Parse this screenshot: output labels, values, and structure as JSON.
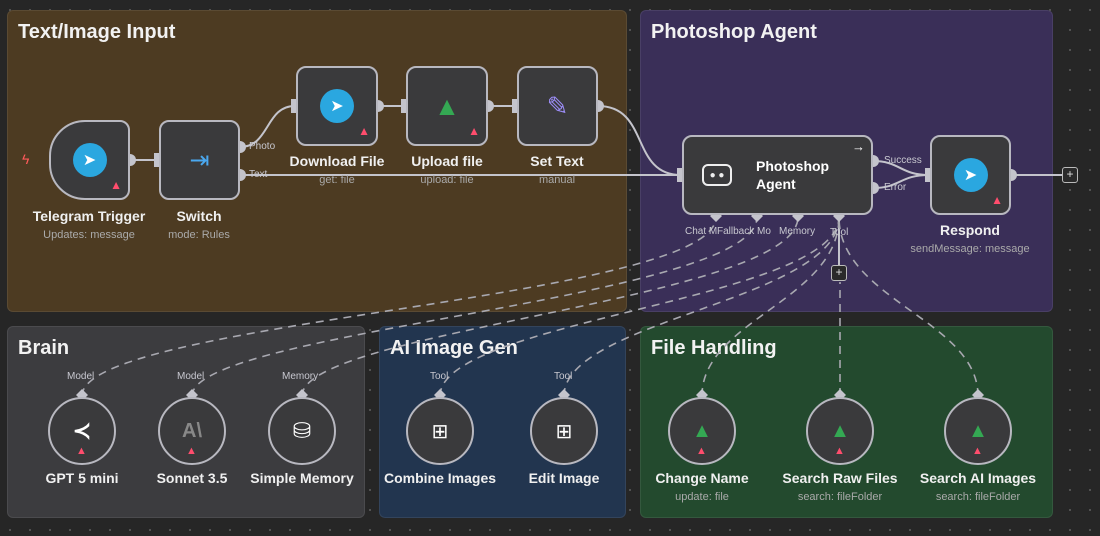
{
  "groups": {
    "input": "Text/Image Input",
    "agent": "Photoshop Agent",
    "brain": "Brain",
    "imagegen": "AI Image Gen",
    "files": "File Handling"
  },
  "nodes": {
    "telegram_trigger": {
      "label": "Telegram Trigger",
      "sub": "Updates: message",
      "icon": "telegram-icon"
    },
    "switch": {
      "label": "Switch",
      "sub": "mode: Rules",
      "outputs": [
        "Photo",
        "Text"
      ],
      "icon": "signpost-icon"
    },
    "download_file": {
      "label": "Download File",
      "sub": "get: file",
      "icon": "telegram-icon"
    },
    "upload_file": {
      "label": "Upload file",
      "sub": "upload: file",
      "icon": "google-drive-icon"
    },
    "set_text": {
      "label": "Set Text",
      "sub": "manual",
      "icon": "pencil-icon"
    },
    "photoshop_agent": {
      "label": "Photoshop Agent",
      "outputs": [
        "Success",
        "Error"
      ],
      "inputs": [
        "Chat M",
        "Fallback Mo",
        "Memory",
        "Tool"
      ],
      "icon": "robot-icon"
    },
    "respond": {
      "label": "Respond",
      "sub": "sendMessage: message",
      "icon": "telegram-icon"
    },
    "gpt": {
      "label": "GPT 5 mini",
      "type": "Model",
      "icon": "openai-icon"
    },
    "sonnet": {
      "label": "Sonnet 3.5",
      "type": "Model",
      "icon": "anthropic-icon"
    },
    "memory": {
      "label": "Simple Memory",
      "type": "Memory",
      "icon": "database-icon"
    },
    "combine": {
      "label": "Combine Images",
      "type": "Tool",
      "icon": "workflow-icon"
    },
    "edit": {
      "label": "Edit Image",
      "type": "Tool",
      "icon": "workflow-icon"
    },
    "change_name": {
      "label": "Change Name",
      "sub": "update: file",
      "icon": "google-drive-icon"
    },
    "search_raw": {
      "label": "Search Raw Files",
      "sub": "search: fileFolder",
      "icon": "google-drive-icon"
    },
    "search_ai": {
      "label": "Search AI Images",
      "sub": "search: fileFolder",
      "icon": "google-drive-icon"
    }
  },
  "colors": {
    "input": "#4d3b22",
    "agent": "#3a2f58",
    "brain": "#3c3c3f",
    "imagegen": "#22354f",
    "files": "#234a2e",
    "warning": "#ff4d6d",
    "telegram": "#2aa7e0"
  }
}
